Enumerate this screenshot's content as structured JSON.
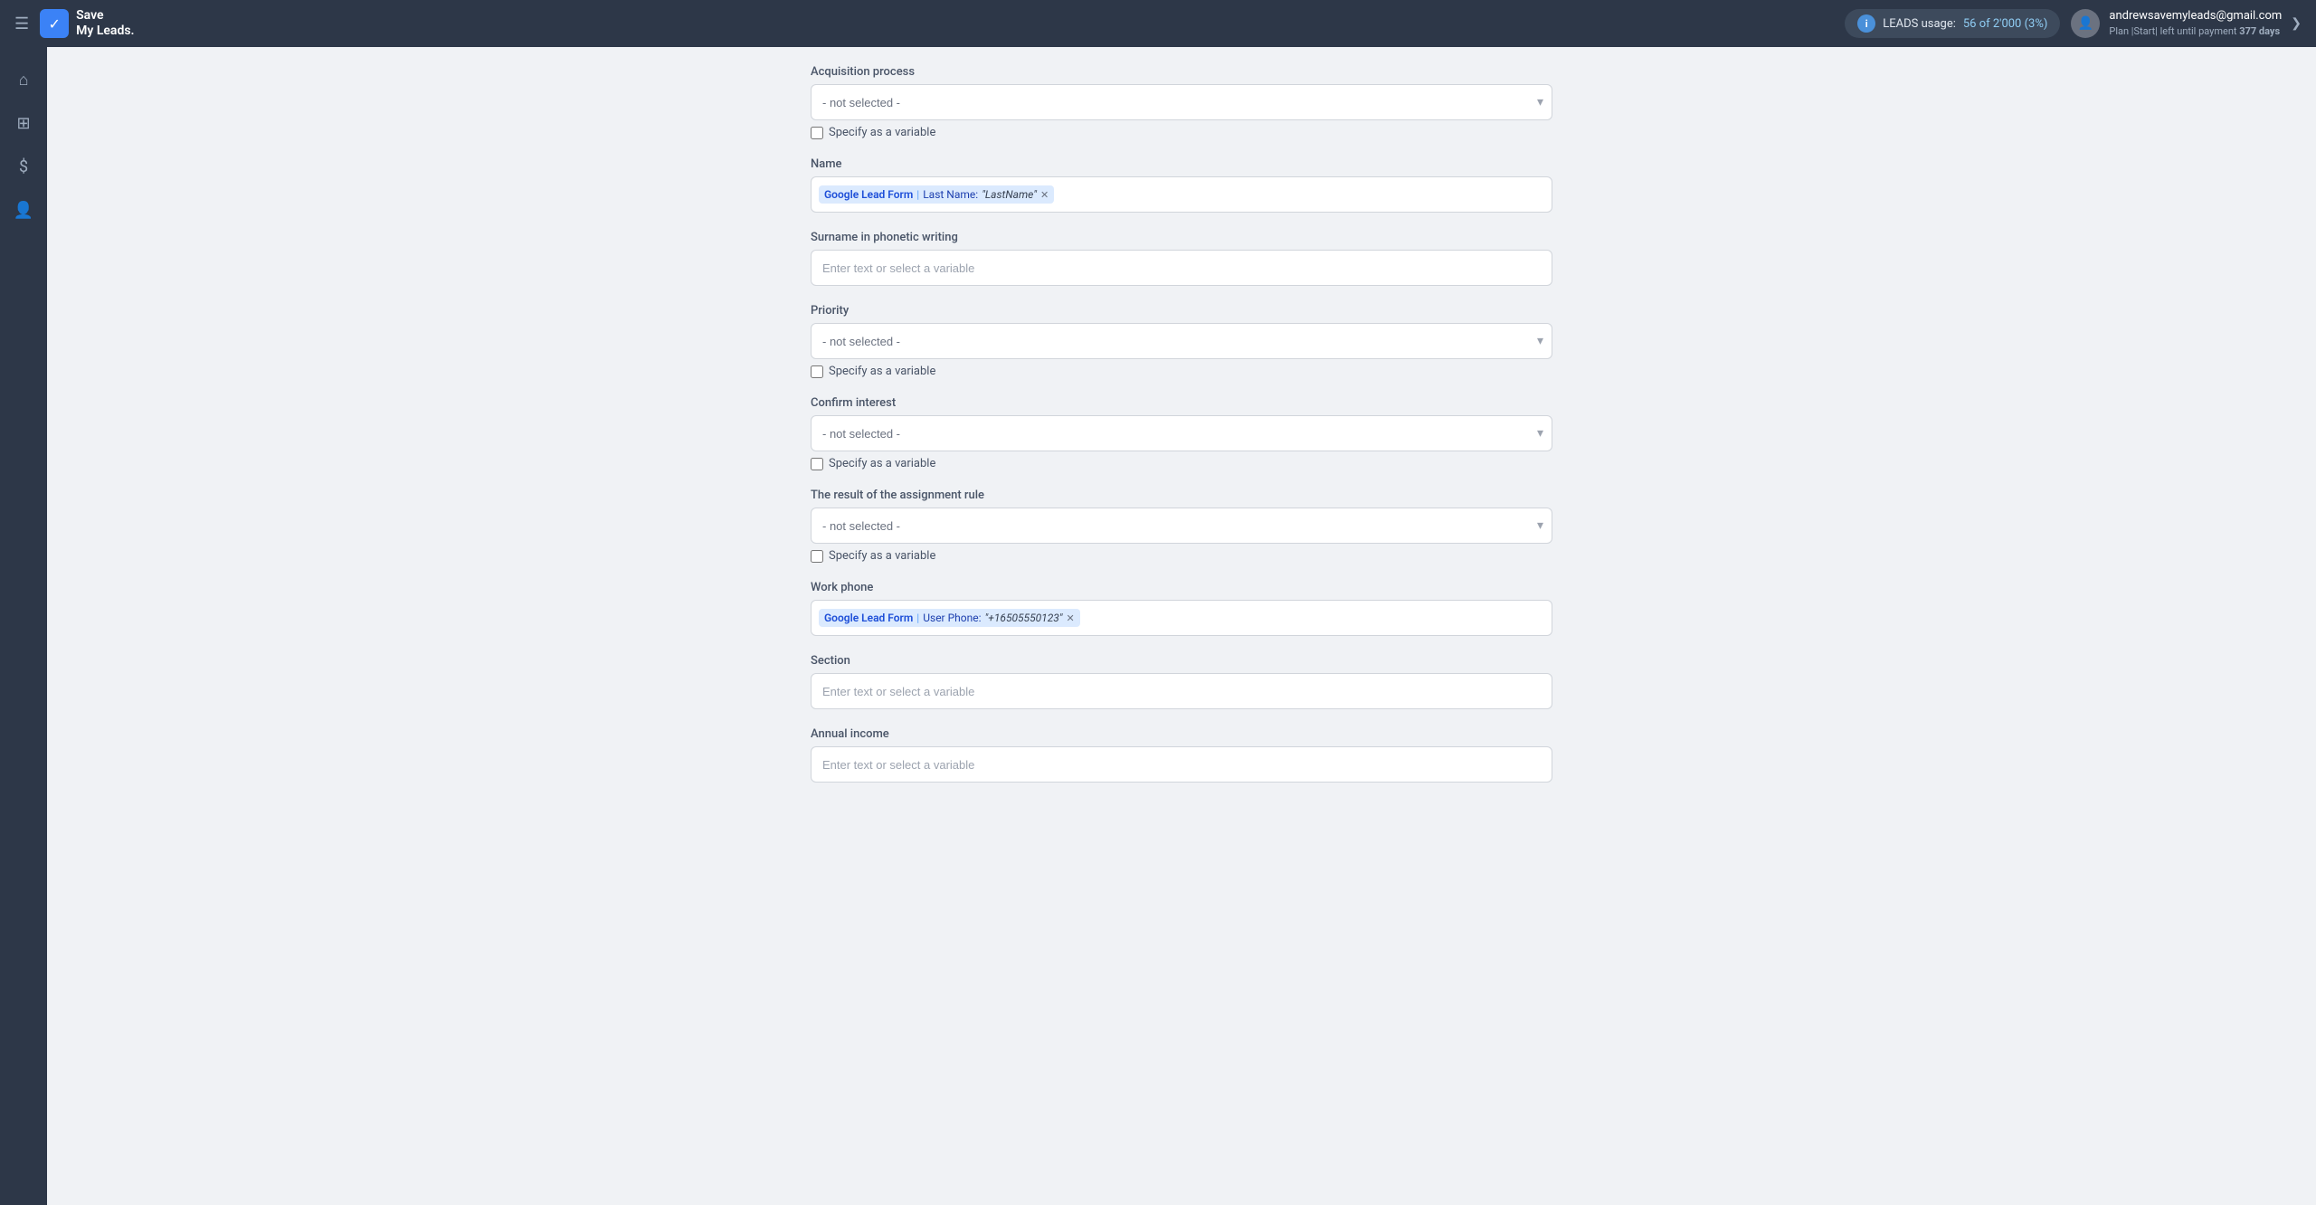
{
  "header": {
    "menu_icon": "☰",
    "logo_text_line1": "Save",
    "logo_text_line2": "My Leads.",
    "logo_check": "✓",
    "leads_usage_label": "LEADS usage:",
    "leads_used": "56",
    "leads_total": "2'000",
    "leads_percent": "3%",
    "leads_display": "56 of 2'000 (3%)",
    "user_email": "andrewsavemyleads@gmail.com",
    "user_plan": "Plan |Start| left until payment",
    "user_days": "377 days",
    "chevron": "❯"
  },
  "sidebar": {
    "items": [
      {
        "icon": "⌂",
        "name": "home"
      },
      {
        "icon": "⊞",
        "name": "grid"
      },
      {
        "icon": "$",
        "name": "billing"
      },
      {
        "icon": "👤",
        "name": "account"
      }
    ]
  },
  "form": {
    "fields": [
      {
        "id": "acquisition_process",
        "label": "Acquisition process",
        "type": "select",
        "placeholder": "- not selected -",
        "has_checkbox": true,
        "checkbox_label": "Specify as a variable"
      },
      {
        "id": "name",
        "label": "Name",
        "type": "tag",
        "tag_source": "Google Lead Form",
        "tag_field": "Last Name:",
        "tag_value": "\"LastName\"",
        "has_checkbox": false
      },
      {
        "id": "surname_phonetic",
        "label": "Surname in phonetic writing",
        "type": "text",
        "placeholder": "Enter text or select a variable",
        "has_checkbox": false
      },
      {
        "id": "priority",
        "label": "Priority",
        "type": "select",
        "placeholder": "- not selected -",
        "has_checkbox": true,
        "checkbox_label": "Specify as a variable"
      },
      {
        "id": "confirm_interest",
        "label": "Confirm interest",
        "type": "select",
        "placeholder": "- not selected -",
        "has_checkbox": true,
        "checkbox_label": "Specify as a variable"
      },
      {
        "id": "assignment_rule",
        "label": "The result of the assignment rule",
        "type": "select",
        "placeholder": "- not selected -",
        "has_checkbox": true,
        "checkbox_label": "Specify as a variable"
      },
      {
        "id": "work_phone",
        "label": "Work phone",
        "type": "tag",
        "tag_source": "Google Lead Form",
        "tag_field": "User Phone:",
        "tag_value": "\"+16505550123\"",
        "has_checkbox": false
      },
      {
        "id": "section",
        "label": "Section",
        "type": "text",
        "placeholder": "Enter text or select a variable",
        "has_checkbox": false
      },
      {
        "id": "annual_income",
        "label": "Annual income",
        "type": "text",
        "placeholder": "Enter text or select a variable",
        "has_checkbox": false
      }
    ]
  }
}
